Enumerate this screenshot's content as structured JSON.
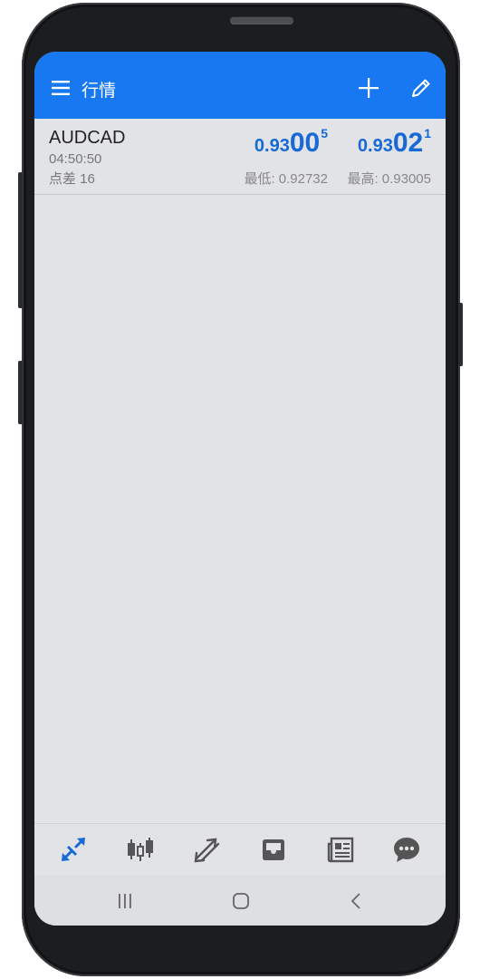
{
  "appbar": {
    "title": "行情",
    "menu_icon": "menu-icon",
    "add_icon": "plus-icon",
    "edit_icon": "pencil-icon",
    "color": "#1778f2"
  },
  "quotes": [
    {
      "symbol": "AUDCAD",
      "time": "04:50:50",
      "spread": "点差 16",
      "bid": {
        "prefix": "0.93",
        "big": "00",
        "sup": "5"
      },
      "ask": {
        "prefix": "0.93",
        "big": "02",
        "sup": "1"
      },
      "low": "最低: 0.92732",
      "high": "最高: 0.93005",
      "price_color": "#1769d6"
    }
  ],
  "bottom_nav": [
    {
      "name": "quotes",
      "icon": "quotes-arrows-icon",
      "active": true
    },
    {
      "name": "chart",
      "icon": "candlestick-icon",
      "active": false
    },
    {
      "name": "trade",
      "icon": "trade-arrows-icon",
      "active": false
    },
    {
      "name": "history",
      "icon": "inbox-tray-icon",
      "active": false
    },
    {
      "name": "news",
      "icon": "newspaper-icon",
      "active": false
    },
    {
      "name": "messages",
      "icon": "chat-bubble-icon",
      "active": false
    }
  ],
  "system_nav": [
    "recent-apps-icon",
    "home-icon",
    "back-icon"
  ]
}
